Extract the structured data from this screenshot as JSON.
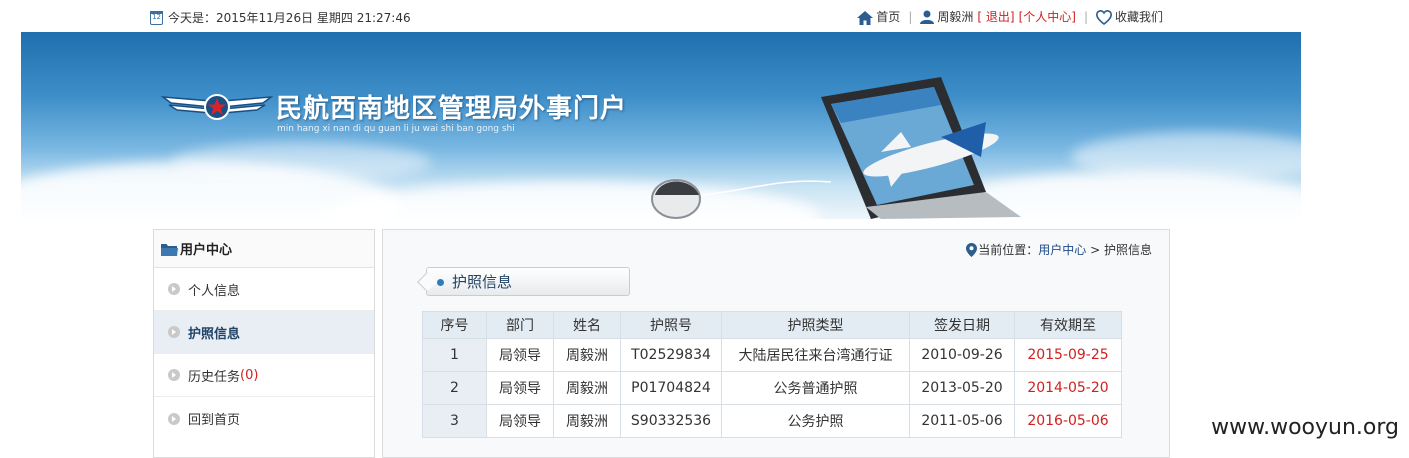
{
  "topbar": {
    "date_text": "今天是：2015年11月26日 星期四 21:27:46",
    "home_label": "首页",
    "user_name": "周毅洲",
    "logout_label": "[ 退出]",
    "user_center_label": "[个人中心]",
    "favorite_label": "收藏我们"
  },
  "banner": {
    "title": "民航西南地区管理局外事门户",
    "subtitle": "min hang xi nan di qu guan li ju wai shi ban gong shi"
  },
  "sidebar": {
    "heading": "用户中心",
    "items": [
      {
        "label": "个人信息"
      },
      {
        "label": "护照信息"
      },
      {
        "label": "历史任务",
        "count": "(0)"
      },
      {
        "label": "回到首页"
      }
    ]
  },
  "breadcrumb": {
    "prefix": "当前位置：",
    "parent": "用户中心",
    "sep": " > ",
    "current": "护照信息"
  },
  "section_title": "护照信息",
  "table": {
    "headers": [
      "序号",
      "部门",
      "姓名",
      "护照号",
      "护照类型",
      "签发日期",
      "有效期至"
    ],
    "rows": [
      [
        "1",
        "局领导",
        "周毅洲",
        "T02529834",
        "大陆居民往来台湾通行证",
        "2010-09-26",
        "2015-09-25"
      ],
      [
        "2",
        "局领导",
        "周毅洲",
        "P01704824",
        "公务普通护照",
        "2013-05-20",
        "2014-05-20"
      ],
      [
        "3",
        "局领导",
        "周毅洲",
        "S90332536",
        "公务护照",
        "2011-05-06",
        "2016-05-06"
      ]
    ]
  },
  "calendar_icon_text": "12",
  "watermark": "www.wooyun.org",
  "colors": {
    "accent": "#224c88",
    "expiry": "#d02020",
    "header_bg": "#e3ebf3"
  }
}
